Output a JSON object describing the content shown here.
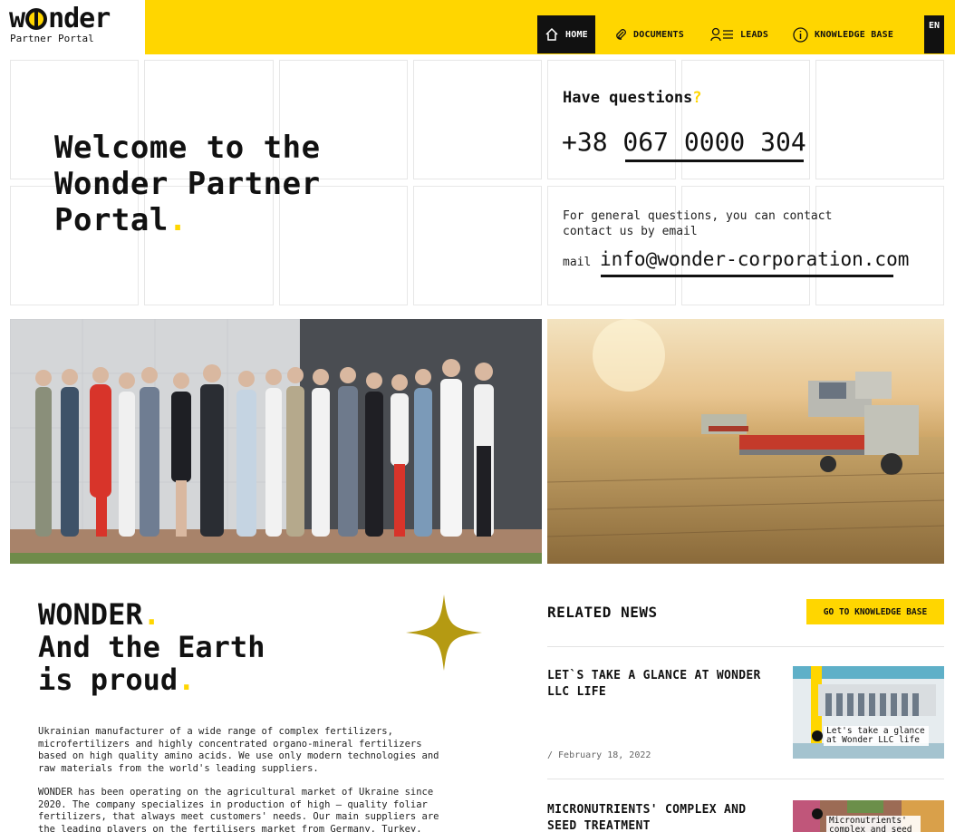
{
  "header": {
    "logo_word": "w nder",
    "logo_sub": "Partner Portal",
    "nav": [
      {
        "label": "HOME",
        "icon": "home-icon",
        "active": true
      },
      {
        "label": "DOCUMENTS",
        "icon": "paperclip-icon",
        "active": false
      },
      {
        "label": "LEADS",
        "icon": "user-list-icon",
        "active": false
      },
      {
        "label": "KNOWLEDGE BASE",
        "icon": "info-icon",
        "active": false
      }
    ],
    "lang": "EN"
  },
  "hero": {
    "title_l1": "Welcome to the",
    "title_l2": "Wonder Partner",
    "title_l3": "Portal",
    "title_dot": "."
  },
  "contact": {
    "questions": "Have questions",
    "questions_mark": "?",
    "phone": "+38 067 0000 304",
    "text": "For general questions, you can contact contact us by email",
    "mail_label": "mail",
    "mail_value": "info@wonder-corporation.com"
  },
  "about": {
    "title_l1": "WONDER",
    "title_l2": "And the Earth",
    "title_l3": "is proud",
    "dot": ".",
    "p1": "Ukrainian manufacturer of a wide range of complex fertilizers, microfertilizers and highly concentrated organo-mineral fertilizers based on high quality amino acids. We use only modern technologies and raw materials from the world's leading suppliers.",
    "p2": "WONDER has been operating on the agricultural market of Ukraine since 2020. The company specializes in production of high – quality foliar fertilizers, that always meet customers' needs. Our main suppliers are the leading players on the fertilisers market from Germany, Turkey,"
  },
  "news": {
    "title": "RELATED NEWS",
    "button": "GO TO KNOWLEDGE BASE",
    "items": [
      {
        "title": "LET`S TAKE A GLANCE AT WONDER LLC LIFE",
        "date": "/ February 18, 2022",
        "thumb_label": "Let's take a glance at Wonder LLC life"
      },
      {
        "title": "MICRONUTRIENTS' COMPLEX AND SEED TREATMENT",
        "date": "",
        "thumb_label": "Micronutrients' complex and seed"
      }
    ]
  },
  "colors": {
    "accent": "#ffd600",
    "dark": "#111111"
  }
}
